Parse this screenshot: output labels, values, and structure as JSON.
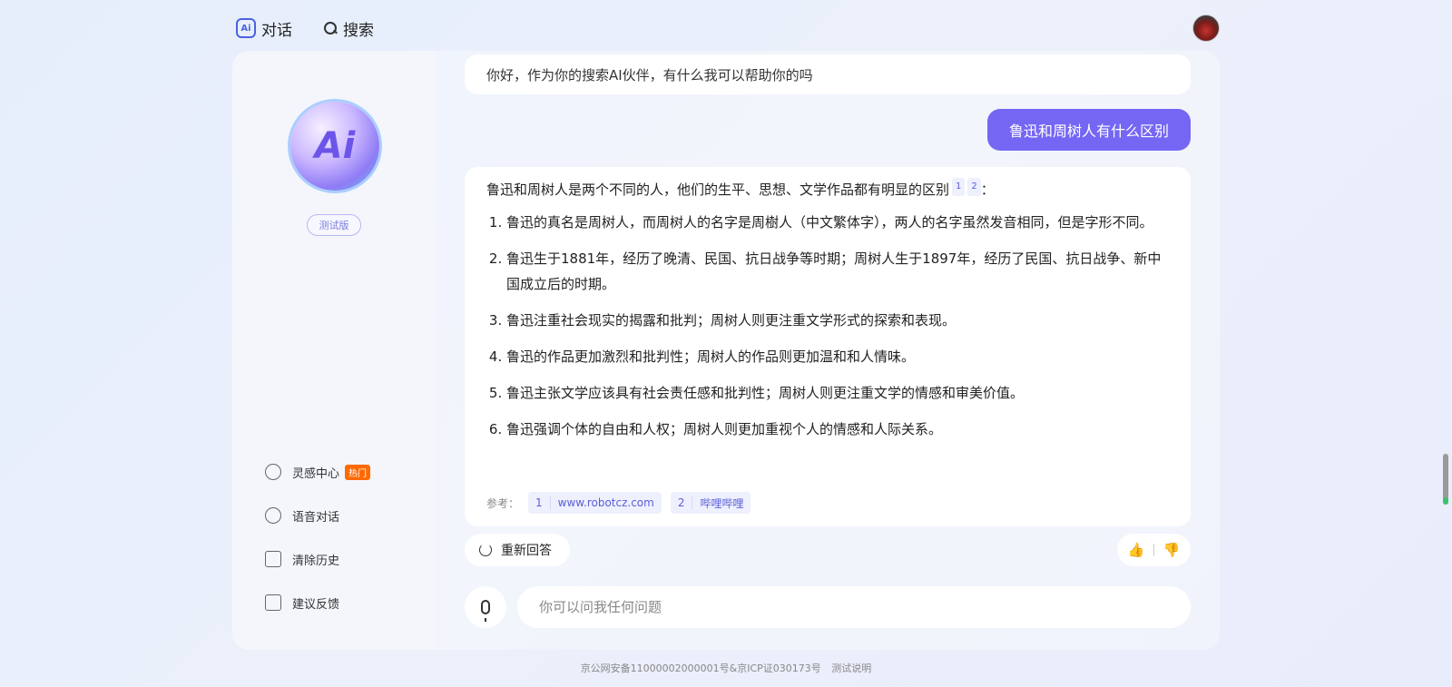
{
  "nav": {
    "dialog_label": "对话",
    "search_label": "搜索"
  },
  "sidebar": {
    "beta_label": "测试版",
    "items": [
      {
        "label": "灵感中心",
        "badge": "热门",
        "icon": "bulb-icon"
      },
      {
        "label": "语音对话",
        "icon": "headphones-icon"
      },
      {
        "label": "清除历史",
        "icon": "trash-icon"
      },
      {
        "label": "建议反馈",
        "icon": "feedback-icon"
      }
    ]
  },
  "chat": {
    "greeting": "你好，作为你的搜索AI伙伴，有什么我可以帮助你的吗",
    "user_question": "鲁迅和周树人有什么区别",
    "answer_intro": "鲁迅和周树人是两个不同的人，他们的生平、思想、文学作品都有明显的区别",
    "answer_intro_refs": [
      "1",
      "2"
    ],
    "answer_intro_tail": "：",
    "answer_items": [
      "鲁迅的真名是周树人，而周树人的名字是周樹人（中文繁体字），两人的名字虽然发音相同，但是字形不同。",
      "鲁迅生于1881年，经历了晚清、民国、抗日战争等时期；周树人生于1897年，经历了民国、抗日战争、新中国成立后的时期。",
      "鲁迅注重社会现实的揭露和批判；周树人则更注重文学形式的探索和表现。",
      "鲁迅的作品更加激烈和批判性；周树人的作品则更加温和和人情味。",
      "鲁迅主张文学应该具有社会责任感和批判性；周树人则更注重文学的情感和审美价值。",
      "鲁迅强调个体的自由和人权；周树人则更加重视个人的情感和人际关系。"
    ],
    "refs_label": "参考：",
    "refs": [
      {
        "num": "1",
        "label": "www.robotcz.com"
      },
      {
        "num": "2",
        "label": "哔哩哔哩"
      }
    ],
    "regen_label": "重新回答",
    "input_placeholder": "你可以问我任何问题"
  },
  "footer": {
    "icp": "京公网安备11000002000001号&京ICP证030173号",
    "test_note": "测试说明"
  }
}
